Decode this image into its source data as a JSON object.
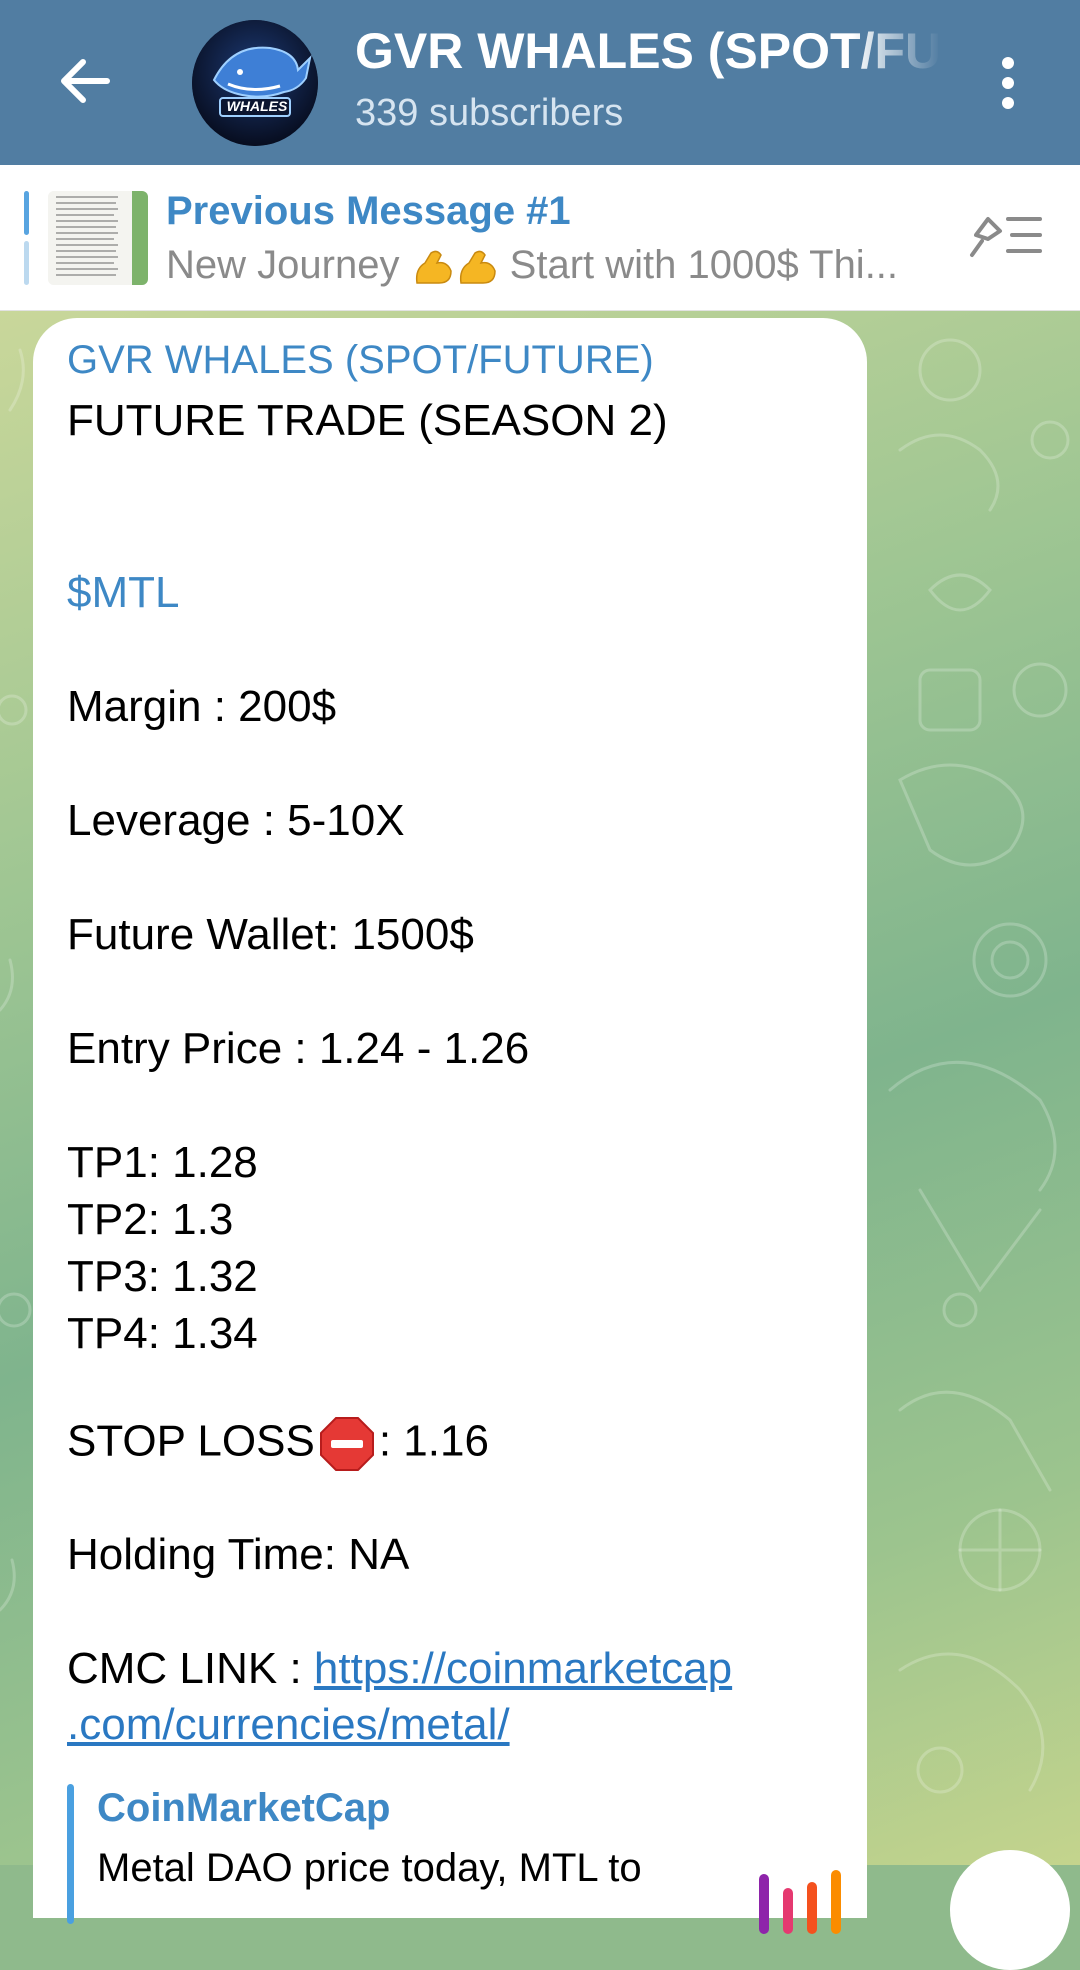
{
  "header": {
    "title": "GVR WHALES (SPOT/FUTURE)",
    "subtitle": "339 subscribers",
    "avatar_text": "WHALES"
  },
  "pinned": {
    "title": "Previous Message #1",
    "preview_before": "New Journey ",
    "preview_after": " Start with 1000$  Thi..."
  },
  "message": {
    "author": "GVR WHALES (SPOT/FUTURE)",
    "heading": "FUTURE TRADE (SEASON 2)",
    "ticker": "$MTL",
    "margin": "Margin : 200$",
    "leverage": "Leverage : 5-10X",
    "wallet": "Future Wallet: 1500$",
    "entry": "Entry Price : 1.24 - 1.26",
    "tp1": "TP1: 1.28",
    "tp2": "TP2: 1.3",
    "tp3": "TP3: 1.32",
    "tp4": "TP4: 1.34",
    "stoploss_label": "STOP LOSS",
    "stoploss_value": ": 1.16",
    "holding": "Holding Time: NA",
    "cmc_label": "CMC LINK : ",
    "cmc_link_line1": "https://coinmarketcap",
    "cmc_link_line2": ".com/currencies/metal/",
    "link_preview": {
      "site": "CoinMarketCap",
      "description": "Metal DAO price today, MTL to"
    }
  },
  "colors": {
    "header_bg": "#517da2",
    "accent_blue": "#3e88c5",
    "link": "#2a78c2"
  },
  "icons": {
    "back": "arrow-left-icon",
    "menu": "more-vertical-icon",
    "pin_list": "pin-list-icon",
    "stop": "stop-sign-emoji",
    "muscle": "flexed-biceps-emoji"
  }
}
